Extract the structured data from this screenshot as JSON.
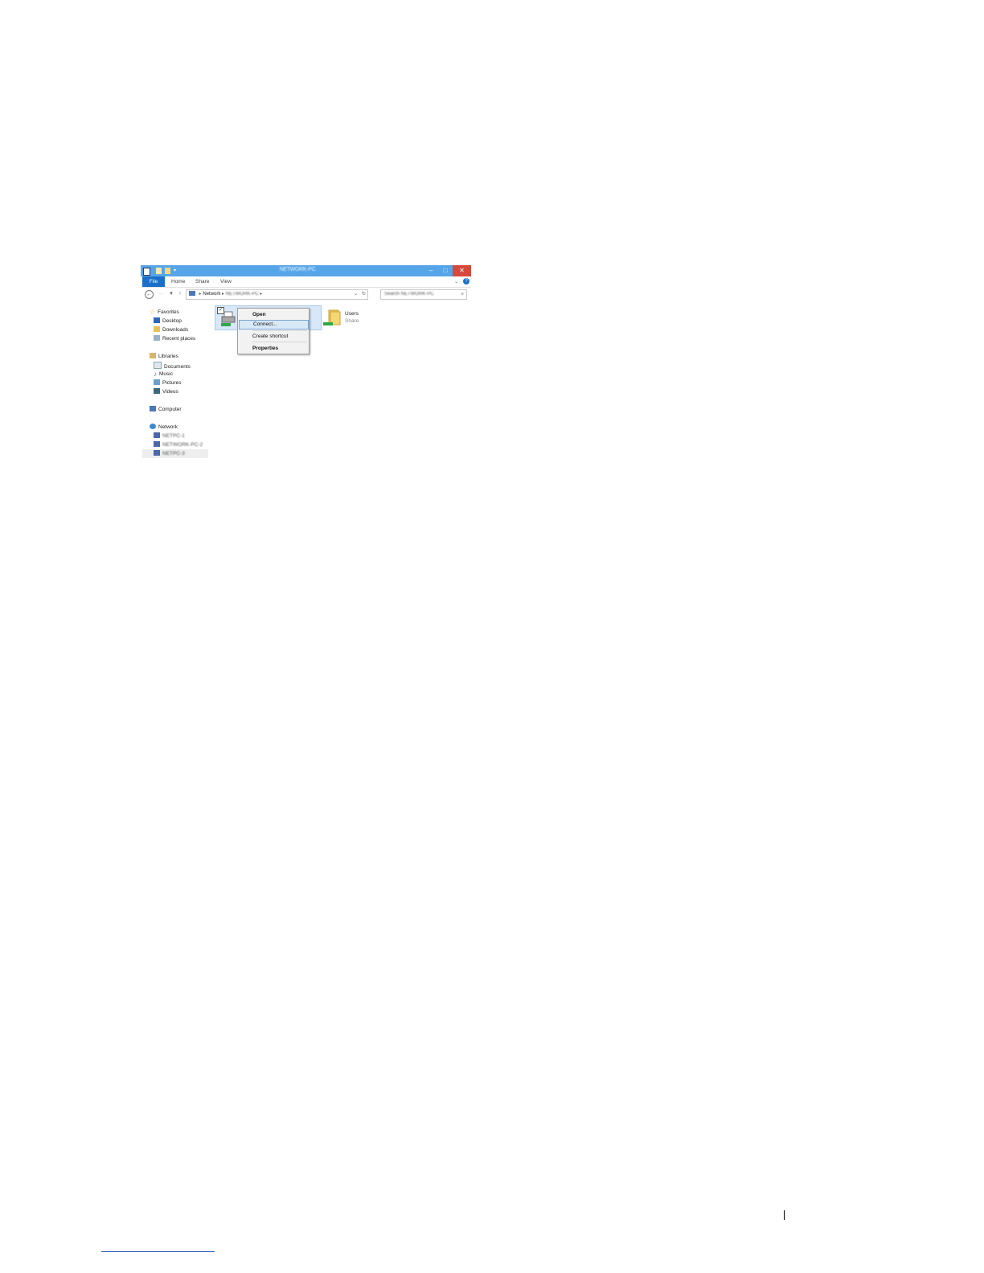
{
  "window": {
    "title": "NETWORK-PC",
    "tabs": [
      "File",
      "Home",
      "Share",
      "View"
    ]
  },
  "address": {
    "root": "Network",
    "computer": "NETWORK-PC",
    "search_placeholder": "Search NETWORK-PC"
  },
  "sidebar": {
    "favorites": {
      "label": "Favorites",
      "items": [
        "Desktop",
        "Downloads",
        "Recent places"
      ]
    },
    "libraries": {
      "label": "Libraries",
      "items": [
        "Documents",
        "Music",
        "Pictures",
        "Videos"
      ]
    },
    "computer": "Computer",
    "network": {
      "label": "Network",
      "items": [
        "NETPC-1",
        "NETWORK-PC-2",
        "NETPC-3"
      ]
    }
  },
  "content": {
    "folder": {
      "name": "Users",
      "subtitle": "Share"
    }
  },
  "context_menu": {
    "items": [
      "Open",
      "Connect...",
      "Create shortcut",
      "Properties"
    ],
    "highlighted_index": 1
  },
  "colors": {
    "titlebar": "#56a5e8",
    "close": "#d4493c",
    "file_tab": "#1b6fc8",
    "selection": "#d8e8f8"
  }
}
